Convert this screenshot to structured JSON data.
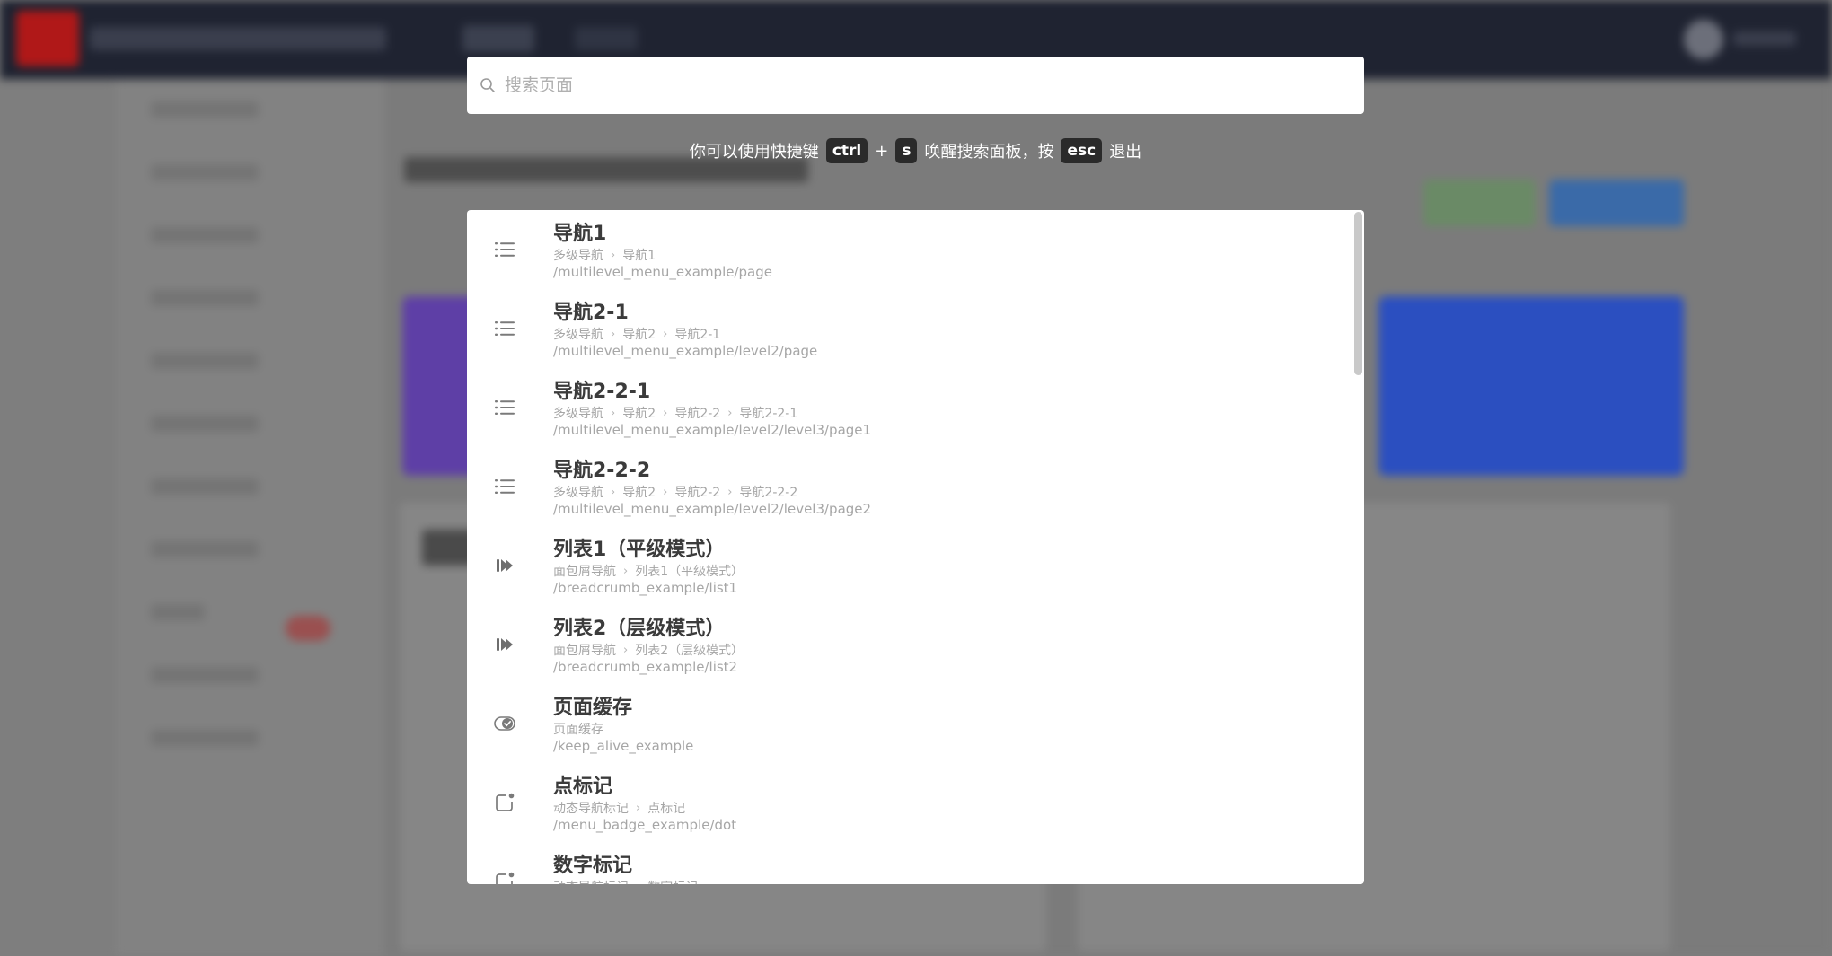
{
  "search": {
    "placeholder": "搜索页面"
  },
  "hint": {
    "before": "你可以使用快捷键",
    "key1": "ctrl",
    "plus": "+",
    "key2": "s",
    "middle": "唤醒搜索面板，按",
    "key3": "esc",
    "after": "退出"
  },
  "results": [
    {
      "icon": "list-icon",
      "title": "导航1",
      "breadcrumb": [
        "多级导航",
        "导航1"
      ],
      "path": "/multilevel_menu_example/page"
    },
    {
      "icon": "list-icon",
      "title": "导航2-1",
      "breadcrumb": [
        "多级导航",
        "导航2",
        "导航2-1"
      ],
      "path": "/multilevel_menu_example/level2/page"
    },
    {
      "icon": "list-icon",
      "title": "导航2-2-1",
      "breadcrumb": [
        "多级导航",
        "导航2",
        "导航2-2",
        "导航2-2-1"
      ],
      "path": "/multilevel_menu_example/level2/level3/page1"
    },
    {
      "icon": "list-icon",
      "title": "导航2-2-2",
      "breadcrumb": [
        "多级导航",
        "导航2",
        "导航2-2",
        "导航2-2-2"
      ],
      "path": "/multilevel_menu_example/level2/level3/page2"
    },
    {
      "icon": "forward-icon",
      "title": "列表1（平级模式）",
      "breadcrumb": [
        "面包屑导航",
        "列表1（平级模式）"
      ],
      "path": "/breadcrumb_example/list1"
    },
    {
      "icon": "forward-icon",
      "title": "列表2（层级模式）",
      "breadcrumb": [
        "面包屑导航",
        "列表2（层级模式）"
      ],
      "path": "/breadcrumb_example/list2"
    },
    {
      "icon": "toggle-check-icon",
      "title": "页面缓存",
      "breadcrumb": [
        "页面缓存"
      ],
      "path": "/keep_alive_example"
    },
    {
      "icon": "badge-dot-icon",
      "title": "点标记",
      "breadcrumb": [
        "动态导航标记",
        "点标记"
      ],
      "path": "/menu_badge_example/dot"
    },
    {
      "icon": "badge-dot-icon",
      "title": "数字标记",
      "breadcrumb": [
        "动态导航标记",
        "数字标记"
      ],
      "path": ""
    }
  ]
}
